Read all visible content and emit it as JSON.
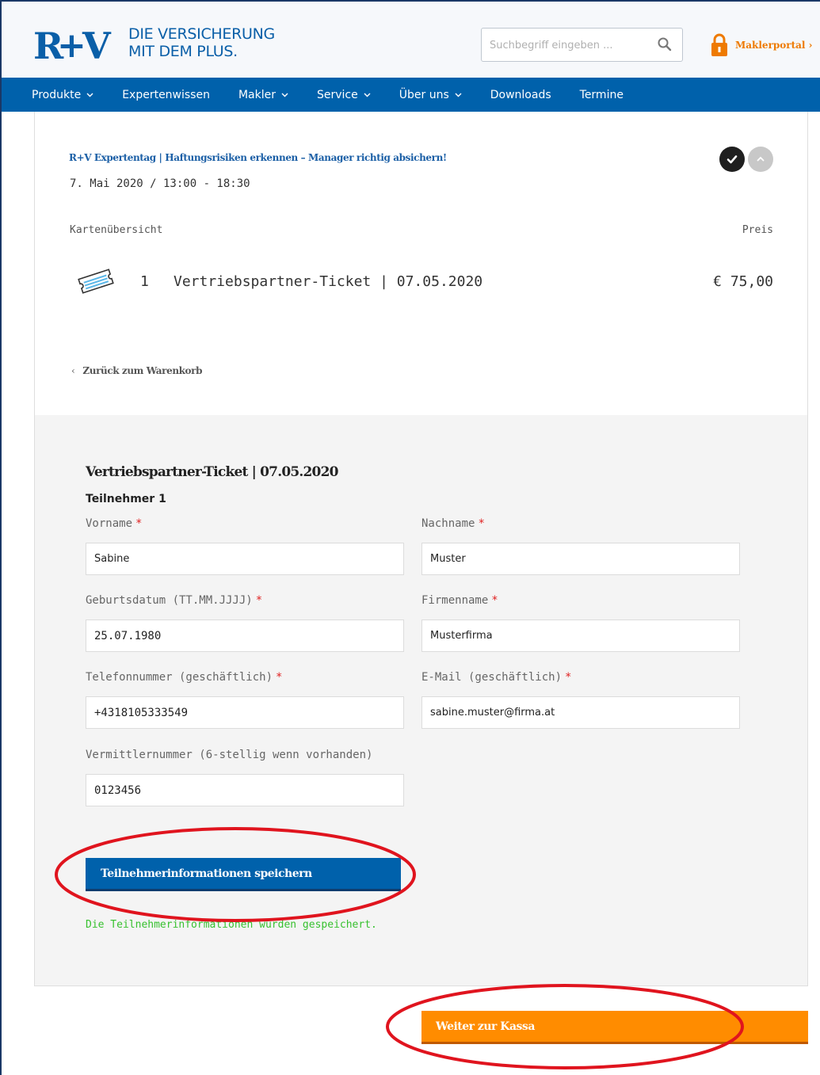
{
  "header": {
    "tagline_line1": "DIE VERSICHERUNG",
    "tagline_line2": "MIT DEM PLUS.",
    "search_placeholder": "Suchbegriff eingeben ...",
    "makler_link": "Maklerportal ›"
  },
  "nav": {
    "items": [
      {
        "label": "Produkte",
        "dropdown": true
      },
      {
        "label": "Expertenwissen",
        "dropdown": false
      },
      {
        "label": "Makler",
        "dropdown": true
      },
      {
        "label": "Service",
        "dropdown": true
      },
      {
        "label": "Über uns",
        "dropdown": true
      },
      {
        "label": "Downloads",
        "dropdown": false
      },
      {
        "label": "Termine",
        "dropdown": false
      }
    ]
  },
  "event": {
    "title": "R+V Expertentag | Haftungsrisiken erkennen – Manager richtig absichern!",
    "date": "7. Mai 2020 / 13:00 - 18:30"
  },
  "overview": {
    "label": "Kartenübersicht",
    "price_label": "Preis",
    "ticket": {
      "qty": "1",
      "name": "Vertriebspartner-Ticket | 07.05.2020",
      "price": "€ 75,00"
    },
    "back_link": "Zurück zum Warenkorb"
  },
  "form": {
    "title": "Vertriebspartner-Ticket | 07.05.2020",
    "participant": "Teilnehmer 1",
    "fields": {
      "vorname": {
        "label": "Vorname",
        "value": "Sabine"
      },
      "nachname": {
        "label": "Nachname",
        "value": "Muster"
      },
      "geburtsdatum": {
        "label": "Geburtsdatum (TT.MM.JJJJ)",
        "value": "25.07.1980"
      },
      "firmenname": {
        "label": "Firmenname",
        "value": "Musterfirma"
      },
      "telefon": {
        "label": "Telefonnummer (geschäftlich)",
        "value": "+4318105333549"
      },
      "email": {
        "label": "E-Mail (geschäftlich)",
        "value": "sabine.muster@firma.at"
      },
      "vermittler": {
        "label": "Vermittlernummer (6-stellig wenn vorhanden)",
        "value": "0123456"
      }
    },
    "required_mark": "*",
    "save_label": "Teilnehmerinformationen speichern",
    "saved_message": "Die Teilnehmerinformationen wurden gespeichert."
  },
  "checkout_label": "Weiter zur Kassa",
  "colors": {
    "brand_blue": "#0061ab",
    "accent_orange": "#ff8c00",
    "annotation_red": "#e0141e",
    "success_green": "#37c12f"
  }
}
